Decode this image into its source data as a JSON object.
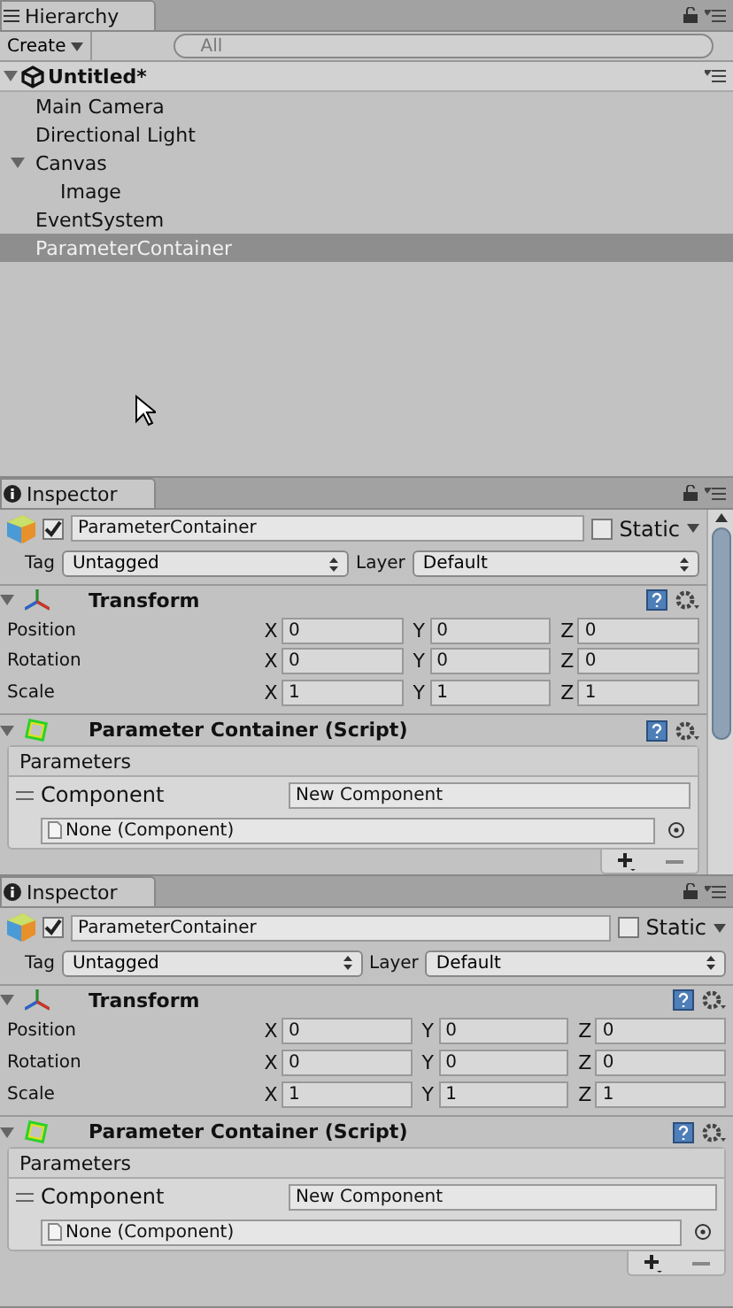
{
  "hierarchy": {
    "tab": "Hierarchy",
    "create": "Create",
    "search_placeholder": "All",
    "scene": "Untitled*",
    "items": [
      {
        "label": "Main Camera",
        "selected": false
      },
      {
        "label": "Directional Light",
        "selected": false
      },
      {
        "label": "Canvas",
        "selected": false,
        "expanded": true,
        "children": [
          {
            "label": "Image",
            "selected": false
          }
        ]
      },
      {
        "label": "EventSystem",
        "selected": false
      },
      {
        "label": "ParameterContainer",
        "selected": true
      }
    ]
  },
  "inspectors": [
    {
      "tab": "Inspector",
      "scrollable": true,
      "active": true,
      "name": "ParameterContainer",
      "static_label": "Static",
      "static": false,
      "tag_label": "Tag",
      "tag": "Untagged",
      "layer_label": "Layer",
      "layer": "Default",
      "transform": {
        "title": "Transform",
        "rows": [
          {
            "label": "Position",
            "values": [
              {
                "axis": "X",
                "value": "0"
              },
              {
                "axis": "Y",
                "value": "0"
              },
              {
                "axis": "Z",
                "value": "0"
              }
            ]
          },
          {
            "label": "Rotation",
            "values": [
              {
                "axis": "X",
                "value": "0"
              },
              {
                "axis": "Y",
                "value": "0"
              },
              {
                "axis": "Z",
                "value": "0"
              }
            ]
          },
          {
            "label": "Scale",
            "values": [
              {
                "axis": "X",
                "value": "1"
              },
              {
                "axis": "Y",
                "value": "1"
              },
              {
                "axis": "Z",
                "value": "1"
              }
            ]
          }
        ]
      },
      "script": {
        "title": "Parameter Container (Script)",
        "list_title": "Parameters",
        "element_label": "Component",
        "element_value": "New Component",
        "object_field": "None (Component)"
      }
    },
    {
      "tab": "Inspector",
      "scrollable": false,
      "active": true,
      "name": "ParameterContainer",
      "static_label": "Static",
      "static": false,
      "tag_label": "Tag",
      "tag": "Untagged",
      "layer_label": "Layer",
      "layer": "Default",
      "transform": {
        "title": "Transform",
        "rows": [
          {
            "label": "Position",
            "values": [
              {
                "axis": "X",
                "value": "0"
              },
              {
                "axis": "Y",
                "value": "0"
              },
              {
                "axis": "Z",
                "value": "0"
              }
            ]
          },
          {
            "label": "Rotation",
            "values": [
              {
                "axis": "X",
                "value": "0"
              },
              {
                "axis": "Y",
                "value": "0"
              },
              {
                "axis": "Z",
                "value": "0"
              }
            ]
          },
          {
            "label": "Scale",
            "values": [
              {
                "axis": "X",
                "value": "1"
              },
              {
                "axis": "Y",
                "value": "1"
              },
              {
                "axis": "Z",
                "value": "1"
              }
            ]
          }
        ]
      },
      "script": {
        "title": "Parameter Container (Script)",
        "list_title": "Parameters",
        "element_label": "Component",
        "element_value": "New Component",
        "object_field": "None (Component)"
      }
    }
  ]
}
